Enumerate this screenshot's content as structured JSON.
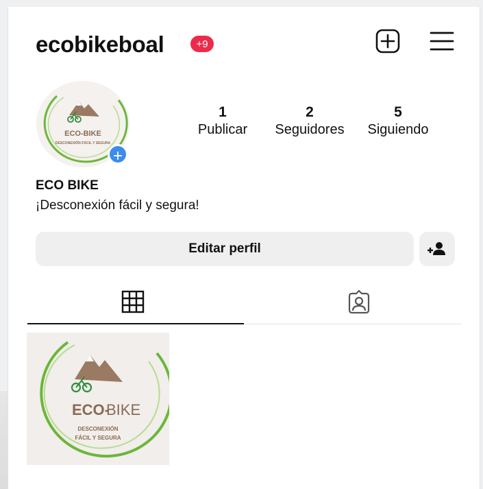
{
  "header": {
    "username": "ecobikeboal",
    "notification_badge": "+9",
    "new_post_icon": "plus-square-icon",
    "menu_icon": "hamburger-menu-icon"
  },
  "profile": {
    "avatar_logo_brand": "ECO-BIKE",
    "avatar_logo_tagline": "DESCONEXIÓN FÁCIL Y SEGURA",
    "display_name": "ECO BIKE",
    "bio": "¡Desconexión fácil y segura!",
    "stats": [
      {
        "value": "1",
        "label": "Publicar"
      },
      {
        "value": "2",
        "label": "Seguidores"
      },
      {
        "value": "5",
        "label": "Siguiendo"
      }
    ],
    "edit_button": "Editar perfil"
  },
  "tabs": [
    {
      "icon": "grid-icon",
      "selected": true
    },
    {
      "icon": "tagged-person-icon",
      "selected": false
    }
  ],
  "posts": [
    {
      "logo_brand_1": "ECO-",
      "logo_brand_2": "BIKE",
      "tagline_1": "DESCONEXIÓN",
      "tagline_2": "FÁCIL Y SEGURA"
    }
  ],
  "colors": {
    "badge": "#ec2b4c",
    "avatar_plus": "#3d8ce9",
    "logo_green": "#6cb63a",
    "logo_brown": "#8a6a55"
  }
}
